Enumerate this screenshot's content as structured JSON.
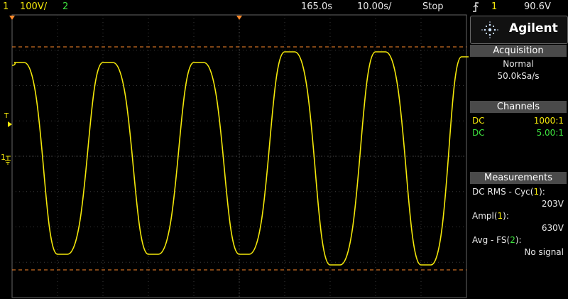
{
  "topbar": {
    "ch1_num": "1",
    "ch1_scale": "100V/",
    "ch2_num": "2",
    "trigger_pos": "165.0s",
    "timebase": "10.00s/",
    "run_state": "Stop",
    "trigger_icon": "trigger-edge-icon",
    "trigger_src": "1",
    "trigger_level": "90.6V"
  },
  "brand": {
    "name": "Agilent",
    "logo_icon": "agilent-spark-icon"
  },
  "acquisition": {
    "title": "Acquisition",
    "mode": "Normal",
    "rate": "50.0kSa/s"
  },
  "channels": {
    "title": "Channels",
    "items": [
      {
        "coupling": "DC",
        "probe": "1000:1",
        "color": "#f4e80a"
      },
      {
        "coupling": "DC",
        "probe": "5.00:1",
        "color": "#3ee23e"
      }
    ]
  },
  "measurements": {
    "title": "Measurements",
    "items": [
      {
        "label_pre": "DC RMS - Cyc(",
        "label_ch": "1",
        "label_post": "):",
        "value": "203V"
      },
      {
        "label_pre": "Ampl(",
        "label_ch": "1",
        "label_post": "):",
        "value": "630V"
      },
      {
        "label_pre": "Avg - FS(",
        "label_ch": "2",
        "label_post": "):",
        "value": "No signal"
      }
    ]
  },
  "markers": {
    "ground": "1",
    "trigger": "T"
  },
  "colors": {
    "ch1": "#f4e80a",
    "ch2": "#3ee23e",
    "cursor": "#ff8a2a",
    "grid": "#555555"
  }
}
